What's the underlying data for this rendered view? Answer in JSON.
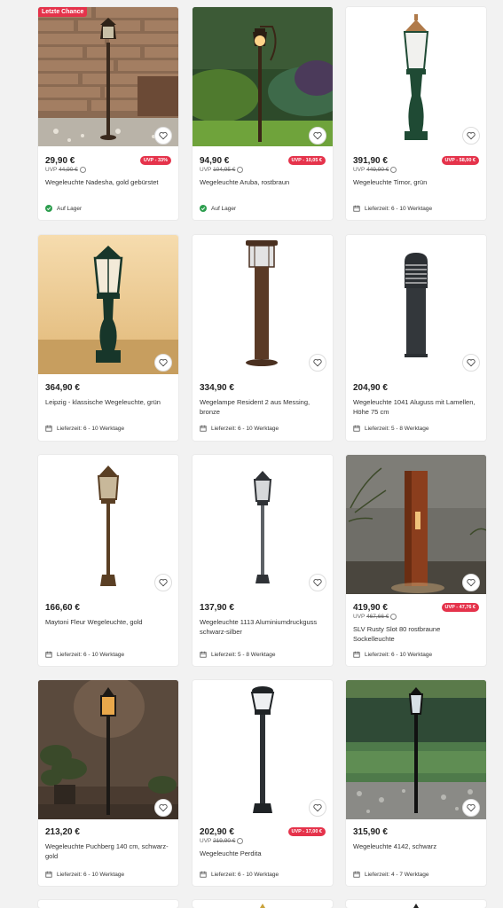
{
  "products": [
    {
      "badge": "Letzte Chance",
      "price": "29,90 €",
      "uvp_prefix": "UVP",
      "uvp": "44,90 €",
      "discount": "UVP - 33%",
      "title": "Wegeleuchte Nadesha, gold gebürstet",
      "availability": "Auf Lager",
      "availability_icon": "check-icon"
    },
    {
      "price": "94,90 €",
      "uvp_prefix": "UVP",
      "uvp": "104,95 €",
      "discount": "UVP - 10,05 €",
      "title": "Wegeleuchte Aruba, rostbraun",
      "availability": "Auf Lager",
      "availability_icon": "check-icon"
    },
    {
      "price": "391,90 €",
      "uvp_prefix": "UVP",
      "uvp": "449,90 €",
      "discount": "UVP - 58,00 €",
      "title": "Wegeleuchte Timor, grün",
      "availability": "Lieferzeit: 6 - 10 Werktage",
      "availability_icon": "calendar-icon"
    },
    {
      "price": "364,90 €",
      "title": "Leipzig - klassische Wegeleuchte, grün",
      "availability": "Lieferzeit: 6 - 10 Werktage",
      "availability_icon": "calendar-icon"
    },
    {
      "price": "334,90 €",
      "title": "Wegelampe Resident 2 aus Messing, bronze",
      "availability": "Lieferzeit: 6 - 10 Werktage",
      "availability_icon": "calendar-icon"
    },
    {
      "price": "204,90 €",
      "title": "Wegeleuchte 1041 Aluguss mit Lamellen, Höhe 75 cm",
      "availability": "Lieferzeit: 5 - 8 Werktage",
      "availability_icon": "calendar-icon"
    },
    {
      "price": "166,60 €",
      "title": "Maytoni Fleur Wegeleuchte, gold",
      "availability": "Lieferzeit: 6 - 10 Werktage",
      "availability_icon": "calendar-icon"
    },
    {
      "price": "137,90 €",
      "title": "Wegeleuchte 1113 Aluminiumdruckguss schwarz-silber",
      "availability": "Lieferzeit: 5 - 8 Werktage",
      "availability_icon": "calendar-icon"
    },
    {
      "price": "419,90 €",
      "uvp_prefix": "UVP",
      "uvp": "467,66 €",
      "discount": "UVP - 47,76 €",
      "title": "SLV Rusty Slot 80 rostbraune Sockelleuchte",
      "availability": "Lieferzeit: 6 - 10 Werktage",
      "availability_icon": "calendar-icon"
    },
    {
      "price": "213,20 €",
      "title": "Wegeleuchte Puchberg 140 cm, schwarz-gold",
      "availability": "Lieferzeit: 6 - 10 Werktage",
      "availability_icon": "calendar-icon"
    },
    {
      "price": "202,90 €",
      "uvp_prefix": "UVP",
      "uvp": "219,90 €",
      "discount": "UVP - 17,00 €",
      "title": "Wegeleuchte Perdita",
      "availability": "Lieferzeit: 6 - 10 Werktage",
      "availability_icon": "calendar-icon"
    },
    {
      "price": "315,90 €",
      "title": "Wegeleuchte 4142, schwarz",
      "availability": "Lieferzeit: 4 - 7 Werktage",
      "availability_icon": "calendar-icon"
    }
  ],
  "colors": {
    "accent_red": "#e5334b",
    "stock_green": "#2e9e4f"
  }
}
